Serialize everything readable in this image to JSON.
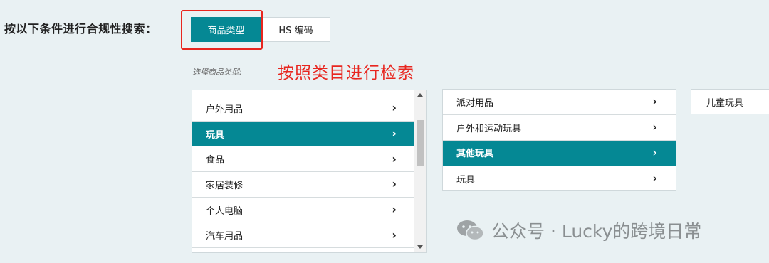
{
  "search": {
    "label": "按以下条件进行合规性搜索："
  },
  "tabs": [
    {
      "label": "商品类型",
      "active": true
    },
    {
      "label": "HS 编码",
      "active": false
    }
  ],
  "select_hint": "选择商品类型:",
  "annotation": "按照类目进行检索",
  "level1": {
    "items": [
      {
        "label": "户外用品",
        "selected": false
      },
      {
        "label": "玩具",
        "selected": true
      },
      {
        "label": "食品",
        "selected": false
      },
      {
        "label": "家居装修",
        "selected": false
      },
      {
        "label": "个人电脑",
        "selected": false
      },
      {
        "label": "汽车用品",
        "selected": false
      }
    ]
  },
  "level2": {
    "items": [
      {
        "label": "派对用品",
        "selected": false
      },
      {
        "label": "户外和运动玩具",
        "selected": false
      },
      {
        "label": "其他玩具",
        "selected": true
      },
      {
        "label": "玩具",
        "selected": false
      }
    ]
  },
  "level3": {
    "items": [
      {
        "label": "儿童玩具"
      }
    ]
  },
  "watermark": {
    "text": "公众号 · Lucky的跨境日常",
    "icon": "wechat-icon"
  },
  "colors": {
    "accent": "#058894",
    "annotation_red": "#e8261f",
    "background": "#e9f1f3"
  }
}
